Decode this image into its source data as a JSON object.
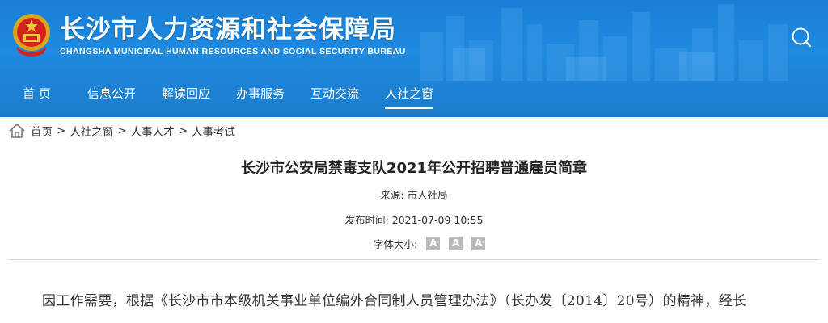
{
  "site": {
    "title_cn": "长沙市人力资源和社会保障局",
    "title_en": "CHANGSHA MUNICIPAL HUMAN RESOURCES AND SOCIAL SECURITY BUREAU"
  },
  "nav": {
    "items": [
      {
        "label": "首 页"
      },
      {
        "label": "信息公开"
      },
      {
        "label": "解读回应"
      },
      {
        "label": "办事服务"
      },
      {
        "label": "互动交流"
      },
      {
        "label": "人社之窗"
      }
    ],
    "active": "人社之窗"
  },
  "breadcrumb": {
    "items": [
      "首页",
      "人社之窗",
      "人事人才",
      "人事考试"
    ],
    "separator": ">"
  },
  "article": {
    "title": "长沙市公安局禁毒支队2021年公开招聘普通雇员简章",
    "source_label": "来源:",
    "source_value": "市人社局",
    "time_label": "发布时间:",
    "time_value": "2021-07-09 10:55",
    "fontsize_label": "字体大小:",
    "fontsize_buttons": [
      "A",
      "A",
      "A"
    ],
    "body_first_line": "因工作需要，根据《长沙市市本级机关事业单位编外合同制人员管理办法》（长办发〔2014〕20号）的精神，经长"
  },
  "icons": {
    "emblem": "national-emblem-icon",
    "search": "search-icon",
    "home": "home-icon"
  },
  "colors": {
    "header_blue": "#1f8ae0",
    "nav_text": "#ffffff",
    "fontsize_btn": "#b9b9b9"
  }
}
